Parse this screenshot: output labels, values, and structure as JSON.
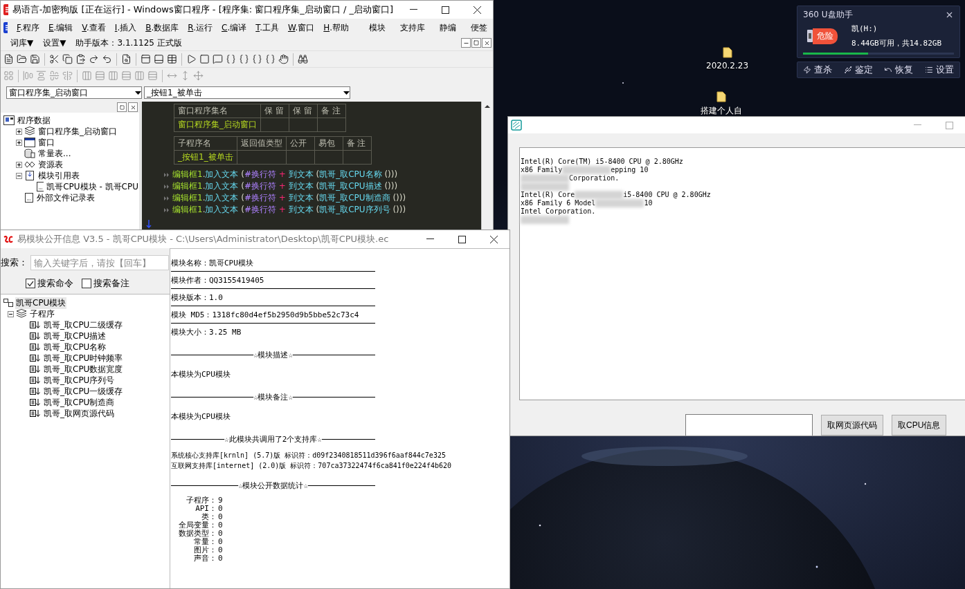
{
  "desktop_icons": [
    {
      "kind": "folder",
      "label": "2020.2.23"
    },
    {
      "kind": "folder",
      "label": "搭建个人自"
    }
  ],
  "ide": {
    "title": "易语言-加密狗版 [正在运行] - Windows窗口程序 - [程序集: 窗口程序集_启动窗口 / _启动窗口]",
    "menu": [
      {
        "accel": "F",
        "label": ".程序"
      },
      {
        "accel": "E",
        "label": ".编辑"
      },
      {
        "accel": "V",
        "label": ".查看"
      },
      {
        "accel": "I",
        "label": ".插入"
      },
      {
        "accel": "B",
        "label": ".数据库"
      },
      {
        "accel": "R",
        "label": ".运行"
      },
      {
        "accel": "C",
        "label": ".编译"
      },
      {
        "accel": "T",
        "label": ".工具"
      },
      {
        "accel": "W",
        "label": ".窗口"
      },
      {
        "accel": "H",
        "label": ".帮助"
      }
    ],
    "extra_menu": [
      "模块",
      "支持库",
      "静编",
      "便签"
    ],
    "second_menu": [
      "词库▼",
      "设置▼"
    ],
    "helper_version": "助手版本：3.1.1125 正式版",
    "class_selector": "窗口程序集_启动窗口",
    "method_selector": "_按钮1_被单击",
    "tree": {
      "label": "程序数据",
      "kind": "root",
      "children": [
        {
          "label": "窗口程序集_启动窗口",
          "kind": "classes",
          "expanded": false
        },
        {
          "label": "窗口",
          "kind": "window",
          "expanded": false
        },
        {
          "label": "常量表...",
          "kind": "constants"
        },
        {
          "label": "资源表",
          "kind": "resources",
          "expanded": false
        },
        {
          "label": "模块引用表",
          "kind": "modules",
          "expanded": true,
          "children": [
            {
              "label": "凯哥CPU模块 - 凯哥CPU",
              "kind": "file"
            }
          ]
        },
        {
          "label": "外部文件记录表",
          "kind": "file"
        }
      ]
    },
    "class_table": {
      "columns": [
        "窗口程序集名",
        "保 留",
        "保 留",
        "备 注"
      ],
      "rows": [
        {
          "name": "窗口程序集_启动窗口"
        }
      ]
    },
    "sub_table": {
      "columns": [
        "子程序名",
        "返回值类型",
        "公开",
        "易包",
        "备 注"
      ],
      "rows": [
        {
          "name": "_按钮1_被单击"
        }
      ]
    },
    "code": [
      [
        {
          "kind": "object",
          "text": "编辑框1"
        },
        {
          "kind": "punct",
          "text": "."
        },
        {
          "kind": "command",
          "text": "加入文本"
        },
        {
          "kind": "punct",
          "text": " ("
        },
        {
          "kind": "constant",
          "text": "#换行符"
        },
        {
          "kind": "operator",
          "text": " + "
        },
        {
          "kind": "command",
          "text": "到文本"
        },
        {
          "kind": "punct",
          "text": " ("
        },
        {
          "kind": "call",
          "text": "凯哥_取CPU名称"
        },
        {
          "kind": "punct",
          "text": " ()))"
        }
      ],
      [
        {
          "kind": "object",
          "text": "编辑框1"
        },
        {
          "kind": "punct",
          "text": "."
        },
        {
          "kind": "command",
          "text": "加入文本"
        },
        {
          "kind": "punct",
          "text": " ("
        },
        {
          "kind": "constant",
          "text": "#换行符"
        },
        {
          "kind": "operator",
          "text": " + "
        },
        {
          "kind": "command",
          "text": "到文本"
        },
        {
          "kind": "punct",
          "text": " ("
        },
        {
          "kind": "call",
          "text": "凯哥_取CPU描述"
        },
        {
          "kind": "punct",
          "text": " ()))"
        }
      ],
      [
        {
          "kind": "object",
          "text": "编辑框1"
        },
        {
          "kind": "punct",
          "text": "."
        },
        {
          "kind": "command",
          "text": "加入文本"
        },
        {
          "kind": "punct",
          "text": " ("
        },
        {
          "kind": "constant",
          "text": "#换行符"
        },
        {
          "kind": "operator",
          "text": " + "
        },
        {
          "kind": "command",
          "text": "到文本"
        },
        {
          "kind": "punct",
          "text": " ("
        },
        {
          "kind": "call",
          "text": "凯哥_取CPU制造商"
        },
        {
          "kind": "punct",
          "text": " ()))"
        }
      ],
      [
        {
          "kind": "object",
          "text": "编辑框1"
        },
        {
          "kind": "punct",
          "text": "."
        },
        {
          "kind": "command",
          "text": "加入文本"
        },
        {
          "kind": "punct",
          "text": " ("
        },
        {
          "kind": "constant",
          "text": "#换行符"
        },
        {
          "kind": "operator",
          "text": " + "
        },
        {
          "kind": "command",
          "text": "到文本"
        },
        {
          "kind": "punct",
          "text": " ("
        },
        {
          "kind": "call",
          "text": "凯哥_取CPU序列号"
        },
        {
          "kind": "punct",
          "text": " ()))"
        }
      ]
    ]
  },
  "module_window": {
    "title": "易模块公开信息 V3.5 - 凯哥CPU模块 - C:\\Users\\Administrator\\Desktop\\凯哥CPU模块.ec",
    "search_label": "搜索：",
    "search": {
      "placeholder": "输入关键字后，请按【回车】"
    },
    "options": [
      {
        "label": "搜索命令",
        "checked": true
      },
      {
        "label": "搜索备注",
        "checked": false
      }
    ],
    "tree": {
      "label": "凯哥CPU模块",
      "selected": true,
      "children": [
        {
          "label": "子程序",
          "selected": false,
          "expanded": true,
          "children": [
            {
              "label": "凯哥_取CPU二级缓存",
              "selected": false
            },
            {
              "label": "凯哥_取CPU描述",
              "selected": false
            },
            {
              "label": "凯哥_取CPU名称",
              "selected": false
            },
            {
              "label": "凯哥_取CPU时钟频率",
              "selected": false
            },
            {
              "label": "凯哥_取CPU数据宽度",
              "selected": false
            },
            {
              "label": "凯哥_取CPU序列号",
              "selected": false
            },
            {
              "label": "凯哥_取CPU一级缓存",
              "selected": false
            },
            {
              "label": "凯哥_取CPU制造商",
              "selected": false
            },
            {
              "label": "凯哥_取网页源代码",
              "selected": false
            }
          ]
        }
      ]
    },
    "info": [
      {
        "kind": "field",
        "text": "模块名称：凯哥CPU模块"
      },
      {
        "kind": "field",
        "text": "模块作者：QQ3155419405"
      },
      {
        "kind": "field",
        "text": "模块版本：1.0"
      },
      {
        "kind": "field",
        "text": "模块 MD5：1318fc80d4ef5b2950d9b5bbe52c73c4"
      },
      {
        "kind": "text",
        "text": "模块大小：3.25 MB"
      },
      {
        "kind": "heading",
        "text": "☆模块描述☆"
      },
      {
        "kind": "text",
        "text": "本模块为CPU模块"
      },
      {
        "kind": "heading",
        "text": "☆模块备注☆"
      },
      {
        "kind": "text",
        "text": "本模块为CPU模块"
      },
      {
        "kind": "heading",
        "text": "☆此模块共调用了2个支持库☆"
      },
      {
        "kind": "library",
        "text": "系统核心支持库[krnln] (5.7)版 标识符：d09f2340818511d396f6aaf844c7e325"
      },
      {
        "kind": "library",
        "text": "互联网支持库[internet] (2.0)版 标识符：707ca37322474f6ca841f0e224f4b620"
      },
      {
        "kind": "heading",
        "text": "☆模块公开数据统计☆"
      }
    ],
    "stats": [
      {
        "label": "子程序：",
        "value": "9"
      },
      {
        "label": "API：",
        "value": "0"
      },
      {
        "label": "类：",
        "value": "0"
      },
      {
        "label": "全局变量：",
        "value": "0"
      },
      {
        "label": "数据类型：",
        "value": "0"
      },
      {
        "label": "常量：",
        "value": "0"
      },
      {
        "label": "图片：",
        "value": "0"
      },
      {
        "label": "声音：",
        "value": "0"
      }
    ]
  },
  "cpu_window": {
    "output": [
      [
        {
          "kind": "text",
          "text": "Intel(R) Core(TM) i5-8400 CPU @ 2.80GHz"
        }
      ],
      [
        {
          "kind": "text",
          "text": "x86 Family"
        },
        {
          "kind": "blur"
        },
        {
          "kind": "text",
          "text": "epping 10"
        }
      ],
      [
        {
          "kind": "blur"
        },
        {
          "kind": "text",
          "text": "Corporation."
        }
      ],
      [
        {
          "kind": "blur"
        }
      ],
      [
        {
          "kind": "text",
          "text": "Intel(R) Core"
        },
        {
          "kind": "blur"
        },
        {
          "kind": "text",
          "text": "i5-8400 CPU @ 2.80GHz"
        }
      ],
      [
        {
          "kind": "text",
          "text": "x86 Family 6 Model"
        },
        {
          "kind": "blur"
        },
        {
          "kind": "text",
          "text": "10"
        }
      ],
      [
        {
          "kind": "text",
          "text": "Intel Corporation."
        }
      ],
      [
        {
          "kind": "blur"
        }
      ]
    ],
    "buttons": [
      "取网页源代码",
      "取CPU信息"
    ]
  },
  "usb_panel": {
    "title": "360 U盘助手",
    "badge": "危险",
    "drive": "凯(H:)",
    "space": "8.44GB可用，共14.82GB",
    "level": 0.43,
    "actions": [
      {
        "kind": "scan",
        "label": "查杀"
      },
      {
        "kind": "identify",
        "label": "鉴定"
      },
      {
        "kind": "restore",
        "label": "恢复"
      },
      {
        "kind": "settings",
        "label": "设置"
      }
    ]
  }
}
